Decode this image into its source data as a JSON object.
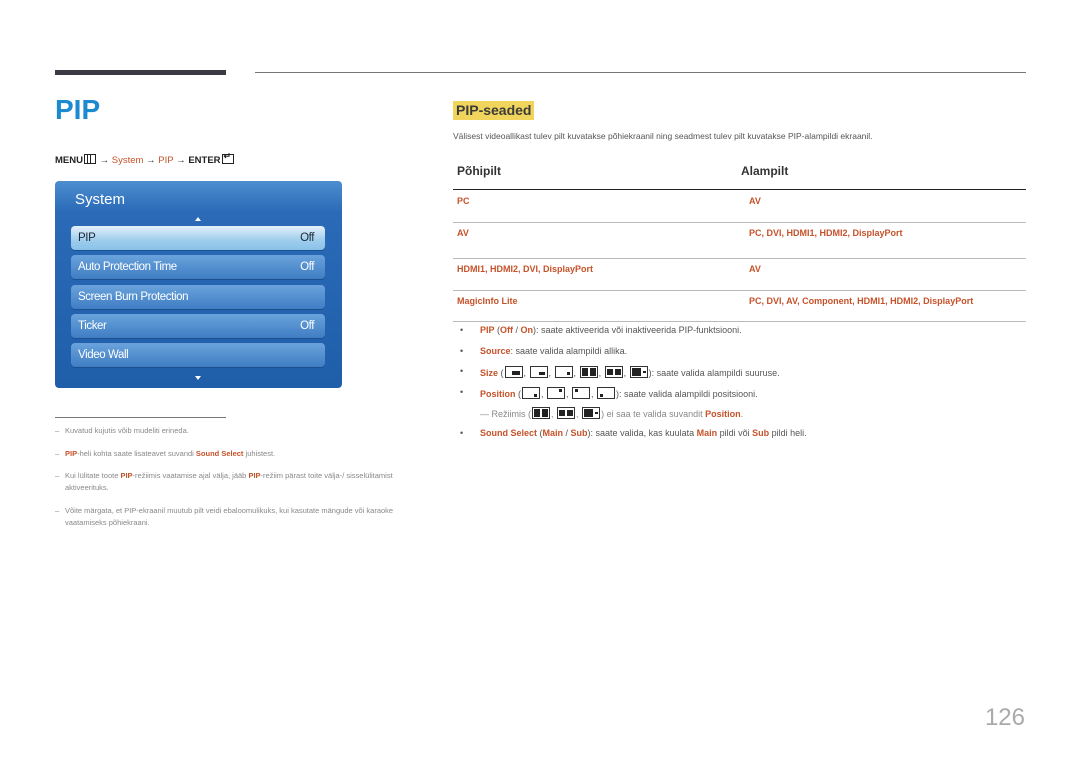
{
  "page": {
    "title": "PIP",
    "page_number": "126"
  },
  "menu_path": {
    "menu": "MENU",
    "arrow": "→",
    "system": "System",
    "pip": "PIP",
    "enter": "ENTER"
  },
  "osd": {
    "title": "System",
    "items": [
      {
        "label": "PIP",
        "value": "Off",
        "selected": true
      },
      {
        "label": "Auto Protection Time",
        "value": "Off"
      },
      {
        "label": "Screen Burn Protection",
        "value": ""
      },
      {
        "label": "Ticker",
        "value": "Off"
      },
      {
        "label": "Video Wall",
        "value": ""
      }
    ]
  },
  "notes": [
    {
      "parts": [
        {
          "t": "Kuvatud kujutis võib mudeliti erineda."
        }
      ]
    },
    {
      "parts": [
        {
          "t": "PIP",
          "h": true
        },
        {
          "t": "-heli kohta saate lisateavet suvandi "
        },
        {
          "t": "Sound Select",
          "h": true
        },
        {
          "t": " juhistest."
        }
      ]
    },
    {
      "parts": [
        {
          "t": "Kui lülitate toote "
        },
        {
          "t": "PIP",
          "h": true
        },
        {
          "t": "-režiimis vaatamise ajal välja, jääb "
        },
        {
          "t": "PIP",
          "h": true
        },
        {
          "t": "-režiim pärast toite välja-/ sisselülitamist aktiveerituks."
        }
      ]
    },
    {
      "parts": [
        {
          "t": "Võite märgata, et PIP-ekraanil muutub pilt veidi ebaloomulikuks, kui kasutate mängude või karaoke vaatamiseks põhiekraani."
        }
      ]
    }
  ],
  "section": {
    "title": "PIP-seaded",
    "intro": "Välisest videoallikast tulev pilt kuvatakse põhiekraanil ning seadmest tulev pilt kuvatakse PIP-alampildi ekraanil."
  },
  "table": {
    "headers": [
      "Põhipilt",
      "Alampilt"
    ],
    "rows": [
      [
        "PC",
        "AV"
      ],
      [
        "AV",
        "PC, DVI, HDMI1, HDMI2, DisplayPort"
      ],
      [
        "HDMI1, HDMI2, DVI, DisplayPort",
        "AV"
      ],
      [
        "MagicInfo Lite",
        "PC, DVI, AV, Component, HDMI1, HDMI2, DisplayPort"
      ]
    ]
  },
  "bullets": {
    "pip": {
      "name": "PIP",
      "off": "Off",
      "on": "On",
      "text": ": saate aktiveerida või inaktiveerida PIP-funktsiooni."
    },
    "source": {
      "name": "Source",
      "text": ": saate valida alampildi allika."
    },
    "size": {
      "name": "Size",
      "text": ": saate valida alampildi suuruse."
    },
    "position": {
      "name": "Position",
      "text": ": saate valida alampildi positsiooni."
    },
    "note": {
      "prefix": "Režiimis",
      "text": " ei saa te valida suvandit ",
      "option": "Position",
      "end": "."
    },
    "sound": {
      "name": "Sound Select",
      "main": "Main",
      "sub": "Sub",
      "text1": ": saate valida, kas kuulata ",
      "text2": " pildi või ",
      "text3": " pildi heli."
    }
  },
  "colors": {
    "title_blue": "#1d8ad0",
    "highlight_orange": "#c5522a",
    "section_highlight": "#f1d45b"
  }
}
